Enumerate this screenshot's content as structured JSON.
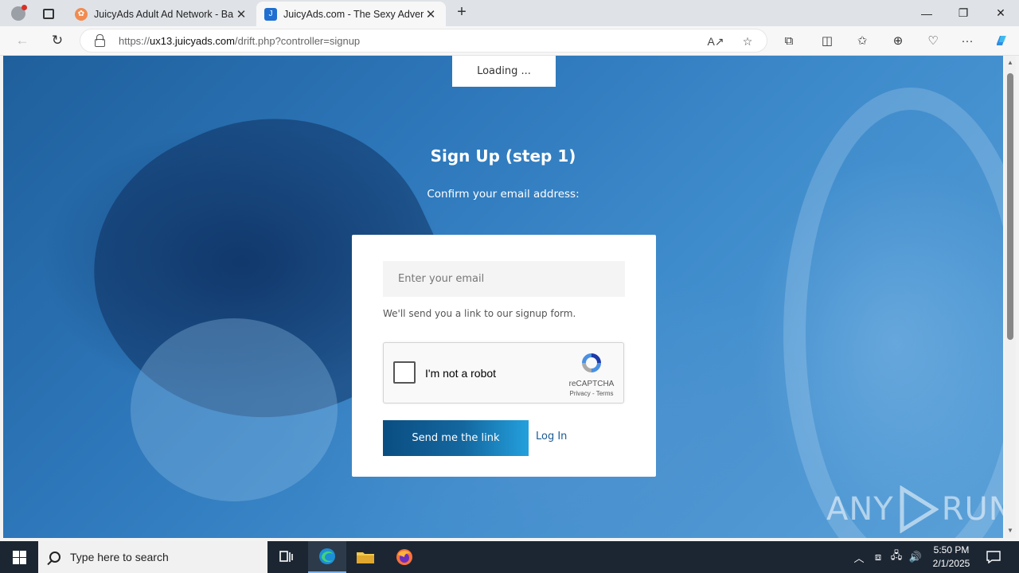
{
  "browser": {
    "tabs": [
      {
        "title": "JuicyAds Adult Ad Network - Ban",
        "active": false
      },
      {
        "title": "JuicyAds.com - The Sexy Adverti",
        "active": true
      }
    ],
    "url_prefix": "https://",
    "url_host": "ux13.juicyads.com",
    "url_path": "/drift.php?controller=signup",
    "icons": [
      "profile-icon",
      "tab-actions-icon",
      "back-icon",
      "refresh-icon",
      "lock-icon",
      "read-aloud-icon",
      "favorite-star-icon",
      "extensions-icon",
      "split-screen-icon",
      "favorites-icon",
      "collections-icon",
      "performance-icon",
      "more-icon",
      "copilot-icon"
    ]
  },
  "page": {
    "loading_text": "Loading ...",
    "title": "Sign Up (step 1)",
    "subtitle": "Confirm your email address:",
    "email_placeholder": "Enter your email",
    "hint": "We'll send you a link to our signup form.",
    "captcha": {
      "label": "I'm not a robot",
      "brand": "reCAPTCHA",
      "links": "Privacy - Terms"
    },
    "send_button": "Send me the link",
    "login_link": "Log In",
    "watermark_left": "ANY",
    "watermark_right": "RUN"
  },
  "taskbar": {
    "search_placeholder": "Type here to search",
    "time": "5:50 PM",
    "date": "2/1/2025"
  },
  "colors": {
    "accent_blue": "#14679f",
    "link": "#1a5a94",
    "background_blue": "#2e78bb"
  }
}
